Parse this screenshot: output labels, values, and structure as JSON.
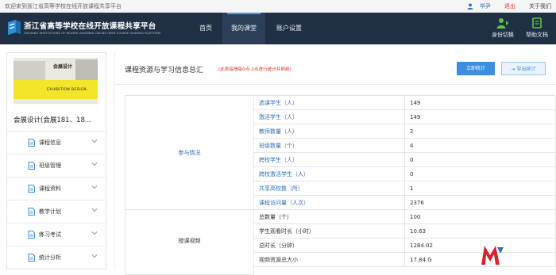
{
  "topbar": {
    "welcome": "欢迎来到浙江省高等学校在线开放课程共享平台",
    "username": "毕尹",
    "logout": "退出",
    "about": "关于我们"
  },
  "header": {
    "title": "浙江省高等学校在线开放课程共享平台",
    "subtitle": "ZHEJIANG INSTITUTIONS OF HIGHER LEARNING ONLINE OPEN COURSE SHARING PLATFORM",
    "nav": {
      "home": "首页",
      "my_course": "我的课堂",
      "settings": "账户设置"
    },
    "switch_identity": "身份切换",
    "help_docs": "帮助文档"
  },
  "sidebar": {
    "cover": {
      "title": "会展设计",
      "subtitle": "EXHIBITION  DESIGN"
    },
    "course_name": "会展设计(会展181、18...",
    "menu": [
      {
        "label": "课程信息",
        "icon": "document-icon"
      },
      {
        "label": "班级管理",
        "icon": "document-icon"
      },
      {
        "label": "课程资料",
        "icon": "document-icon"
      },
      {
        "label": "教学计划",
        "icon": "document-icon"
      },
      {
        "label": "练习考试",
        "icon": "document-icon"
      },
      {
        "label": "统计分析",
        "icon": "document-icon"
      }
    ]
  },
  "main": {
    "title": "课程资源与学习信息总汇",
    "note": "(此表每隔每0点-2点进行统计并刷新)",
    "btn_stat": "立即统计",
    "btn_export": "导出统计",
    "groups": {
      "participation": "参与情况",
      "video": "授课视频"
    },
    "rows": [
      {
        "label": "选课学生（人）",
        "value": "149"
      },
      {
        "label": "激活学生（人）",
        "value": "149"
      },
      {
        "label": "教师数量（人）",
        "value": "2"
      },
      {
        "label": "班级数量（个）",
        "value": "4"
      },
      {
        "label": "跨校学生（人）",
        "value": "0"
      },
      {
        "label": "跨校激活学生（人）",
        "value": "0"
      },
      {
        "label": "共享高校数（所）",
        "value": "1"
      },
      {
        "label": "课程访问量（人次）",
        "value": "2376"
      },
      {
        "label": "总数量（个）",
        "value": "100"
      },
      {
        "label": "学生观看时长（小时）",
        "value": "10.63"
      },
      {
        "label": "总时长（分钟）",
        "value": "1284.02"
      },
      {
        "label": "视频资源总大小",
        "value": "17.84 G"
      }
    ]
  },
  "colors": {
    "header_bg": "#1f2f44",
    "accent_blue": "#3d8de0",
    "link_blue": "#2f6fb8",
    "alert_red": "#d23b2d",
    "cover_yellow": "#f2e52a"
  }
}
